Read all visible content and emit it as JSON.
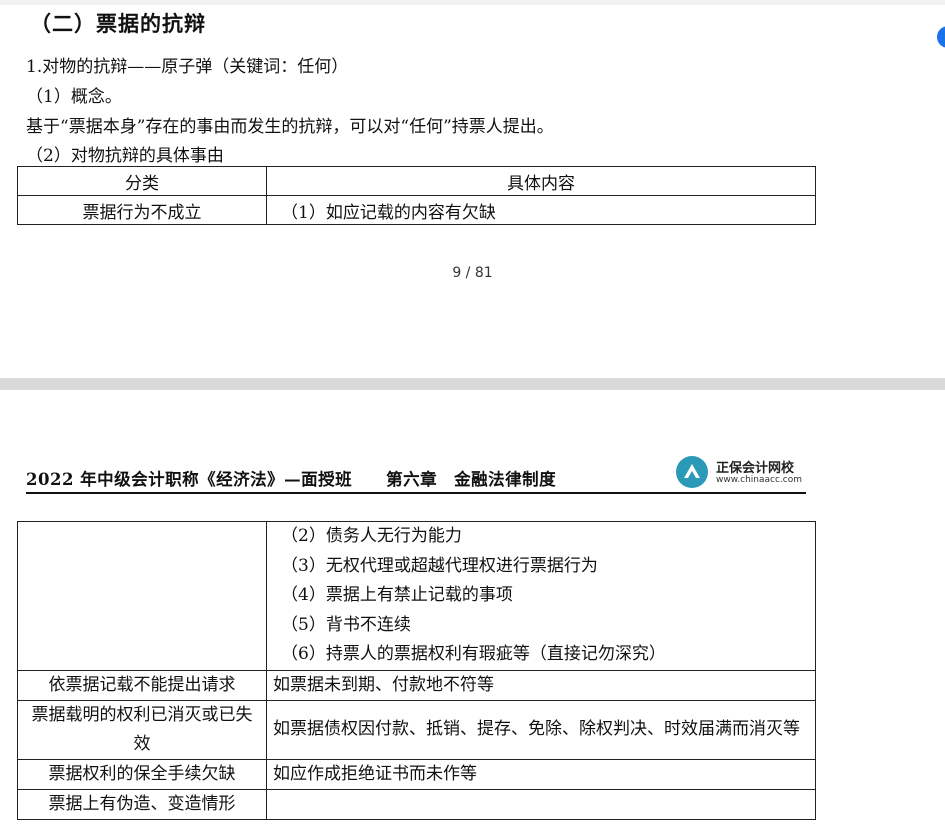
{
  "page1": {
    "heading": "（二）票据的抗辩",
    "line1": "1.对物的抗辩——原子弹（关键词：任何）",
    "line2": "（1）概念。",
    "line3": "基于“票据本身”存在的事由而发生的抗辩，可以对“任何”持票人提出。",
    "line4": "（2）对物抗辩的具体事由",
    "table": {
      "headers": [
        "分类",
        "具体内容"
      ],
      "row1": [
        "票据行为不成立",
        "（1）如应记载的内容有欠缺"
      ]
    },
    "page_number": "9 / 81"
  },
  "page2": {
    "header_title": "2022 年中级会计职称《经济法》—面授班　　第六章　金融法律制度",
    "logo_name": "正保会计网校",
    "logo_url": "www.chinaacc.com",
    "table": {
      "cont_items": [
        "（2）债务人无行为能力",
        "（3）无权代理或超越代理权进行票据行为",
        "（4）票据上有禁止记载的事项",
        "（5）背书不连续",
        "（6）持票人的票据权利有瑕疵等（直接记勿深究）"
      ],
      "row2": [
        "依票据记载不能提出请求",
        "如票据未到期、付款地不符等"
      ],
      "row3": [
        "票据载明的权利已消灭或已失效",
        "如票据债权因付款、抵销、提存、免除、除权判决、时效届满而消灭等"
      ],
      "row4": [
        "票据权利的保全手续欠缺",
        "如应作成拒绝证书而未作等"
      ],
      "row5": [
        "票据上有伪造、变造情形",
        ""
      ]
    }
  },
  "colors": {
    "border": "#222222",
    "separator": "#d9d9d9",
    "logo": "#2a9ab8",
    "side_button": "#1a73e8"
  }
}
